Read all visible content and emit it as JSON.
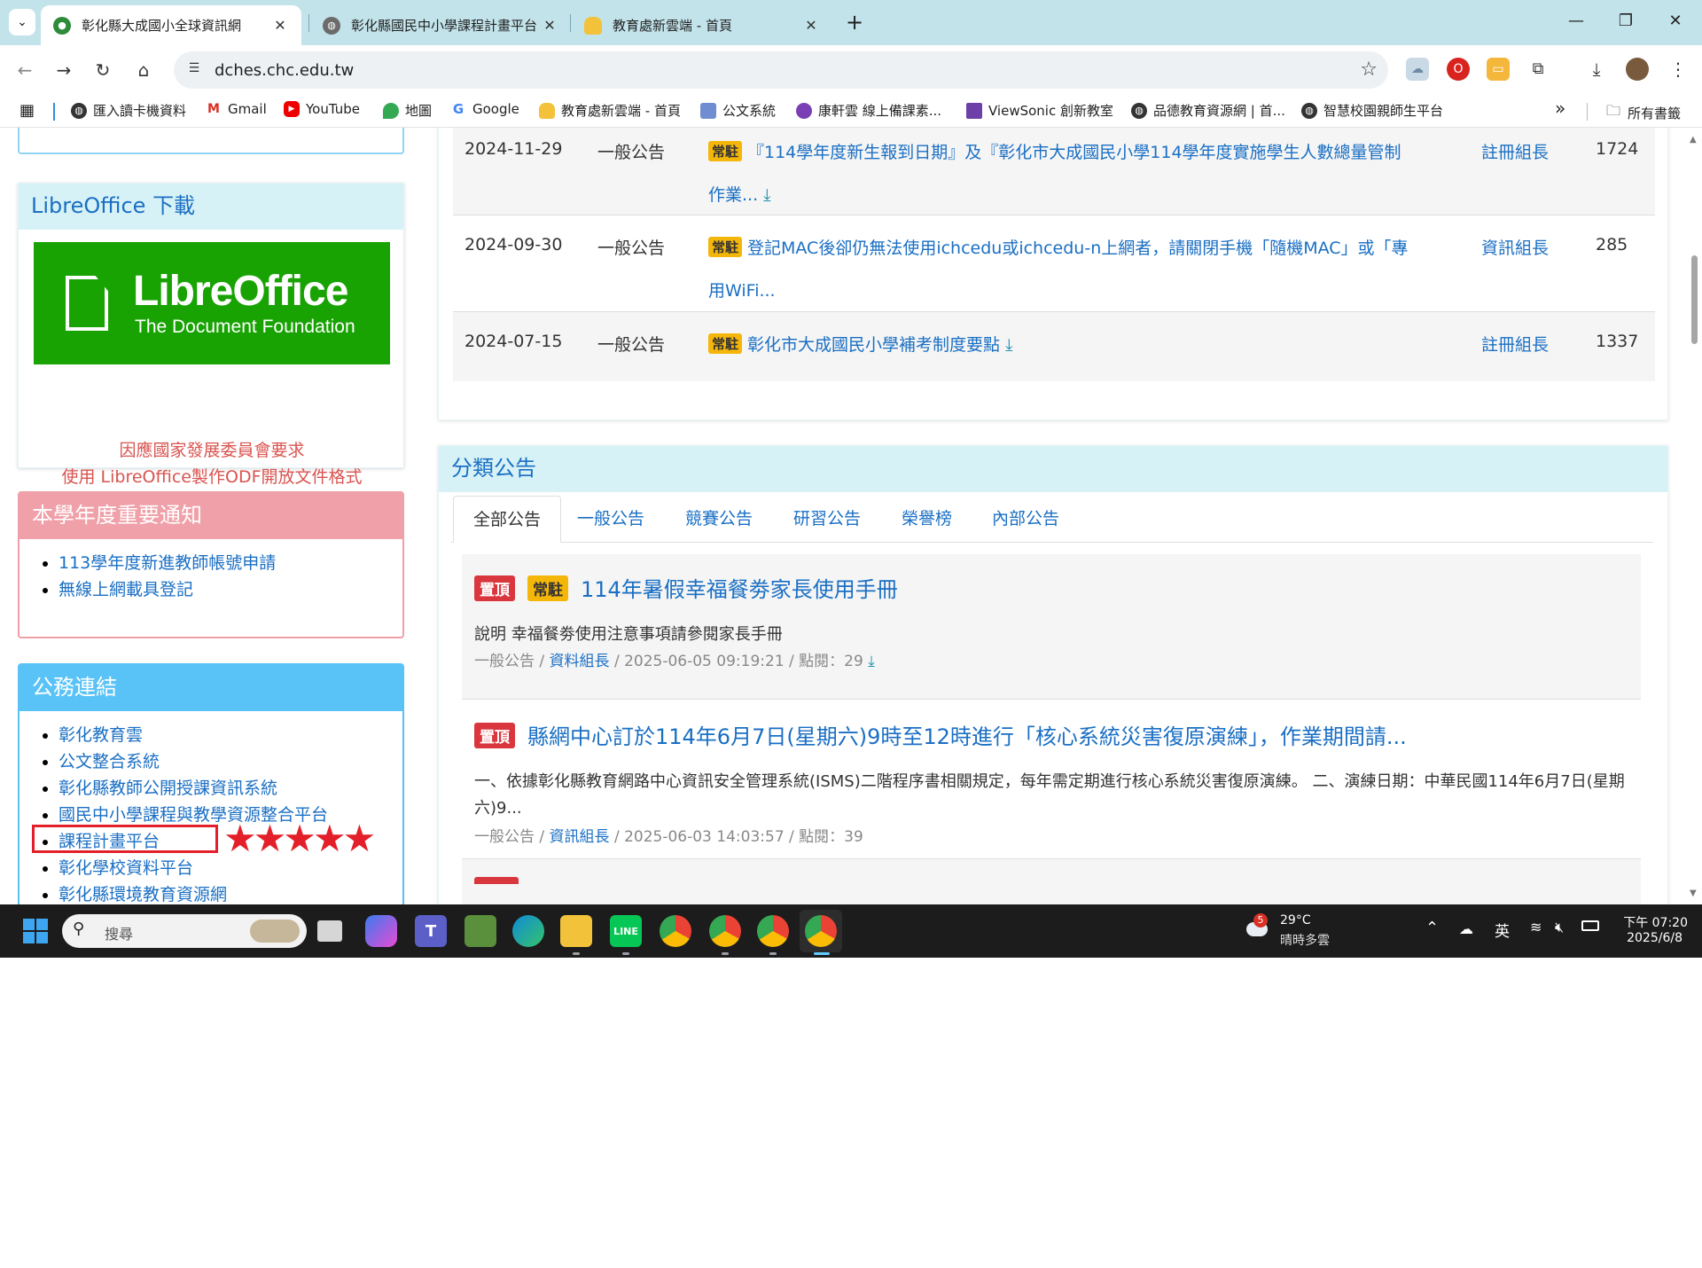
{
  "browser": {
    "tabs": [
      {
        "title": "彰化縣大成國小全球資訊網",
        "active": true
      },
      {
        "title": "彰化縣國民中小學課程計畫平台",
        "active": false
      },
      {
        "title": "教育處新雲端 - 首頁",
        "active": false
      }
    ],
    "new_tab": "+",
    "url": "dches.chc.edu.tw"
  },
  "bookmarks": [
    "匯入讀卡機資料",
    "Gmail",
    "YouTube",
    "地圖",
    "Google",
    "教育處新雲端 - 首頁",
    "公文系統",
    "康軒雲 線上備課素...",
    "ViewSonic 創新教室",
    "品德教育資源網 | 首...",
    "智慧校園親師生平台"
  ],
  "bookmarks_more": "»",
  "bookmarks_all": "所有書籤",
  "sidebar": {
    "libre": {
      "title": "LibreOffice 下載",
      "logo_name": "LibreOffice",
      "logo_sub": "The Document Foundation",
      "note1": "因應國家發展委員會要求",
      "note2": "使用 LibreOffice製作ODF開放文件格式"
    },
    "notice": {
      "title": "本學年度重要通知",
      "items": [
        "113學年度新進教師帳號申請",
        "無線上網載具登記"
      ]
    },
    "links": {
      "title": "公務連結",
      "items": [
        "彰化教育雲",
        "公文整合系統",
        "彰化縣教師公開授課資訊系統",
        "國民中小學課程與教學資源整合平台",
        "課程計畫平台",
        "彰化學校資料平台",
        "彰化縣環境教育資源網"
      ]
    }
  },
  "top_table": {
    "rows": [
      {
        "date": "2024-11-29",
        "category": "一般公告",
        "badge": "常駐",
        "title": "『114學年度新生報到日期』及『彰化市大成國民小學114學年度實施學生人數總量管制",
        "title2": "作業...",
        "author": "註冊組長",
        "clicks": "1724"
      },
      {
        "date": "2024-09-30",
        "category": "一般公告",
        "badge": "常駐",
        "title": "登記MAC後卻仍無法使用ichcedu或ichcedu-n上網者，請關閉手機「隨機MAC」或「專",
        "title2": "用WiFi...",
        "author": "資訊組長",
        "clicks": "285"
      },
      {
        "date": "2024-07-15",
        "category": "一般公告",
        "badge": "常駐",
        "title": "彰化市大成國民小學補考制度要點",
        "title2": "",
        "author": "註冊組長",
        "clicks": "1337"
      }
    ]
  },
  "category_news": {
    "title": "分類公告",
    "tabs": [
      "全部公告",
      "一般公告",
      "競賽公告",
      "研習公告",
      "榮譽榜",
      "內部公告"
    ],
    "posts": [
      {
        "badges": [
          "置頂",
          "常駐"
        ],
        "title": "114年暑假幸福餐劵家長使用手冊",
        "desc": "說明 幸福餐劵使用注意事項請參閱家長手冊",
        "meta_cat": "一般公告 / ",
        "meta_author": "資料組長",
        "meta_rest": " / 2025-06-05 09:19:21 / 點閱：29"
      },
      {
        "badges": [
          "置頂"
        ],
        "title": "縣網中心訂於114年6月7日(星期六)9時至12時進行「核心系統災害復原演練」，作業期間請...",
        "desc": "一、依據彰化縣教育網路中心資訊安全管理系統(ISMS)二階程序書相關規定，每年需定期進行核心系統災害復原演練。 二、演練日期：中華民國114年6月7日(星期六)9...",
        "meta_cat": "一般公告 / ",
        "meta_author": "資訊組長",
        "meta_rest": " / 2025-06-03 14:03:57 / 點閱：39"
      }
    ]
  },
  "taskbar": {
    "search_placeholder": "搜尋",
    "weather_badge": "5",
    "weather_temp": "29°C",
    "weather_desc": "晴時多雲",
    "ime": "英",
    "time": "下午 07:20",
    "date": "2025/6/8"
  },
  "colors": {
    "tabstrip": "#c2e3ea",
    "link": "#1a6fc4",
    "libre_green": "#18a303",
    "notice_red": "#f0a0a8",
    "links_blue": "#59c3f7",
    "badge_top": "#d9363e",
    "badge_pin": "#f5b60a",
    "highlight_red": "#e3202a"
  }
}
